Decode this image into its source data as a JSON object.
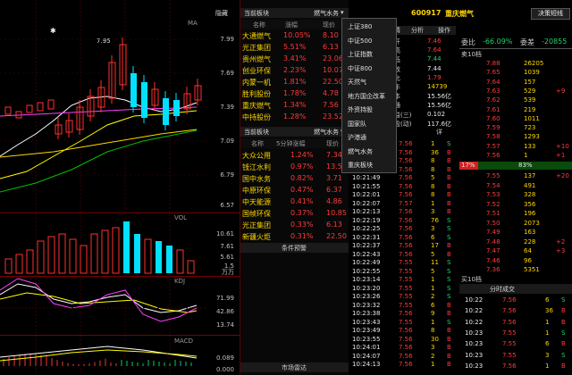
{
  "top_bar": {
    "hide_label": "隐藏",
    "watch_tab": "当前板块",
    "sector_tab": "燃气水务",
    "code": "600917",
    "name": "重庆燃气",
    "decide_button": "决策短线"
  },
  "chart": {
    "indicator_ma": "MA",
    "indicator_vol": "VOL",
    "indicator_kdj": "KDJ",
    "indicator_macd": "MACD",
    "peak_label": "7.95",
    "price_axis": [
      "7.99",
      "7.69",
      "7.39",
      "7.09",
      "6.79",
      "6.57"
    ],
    "vol_axis": [
      "10.61",
      "7.61",
      "5.61",
      "1.5",
      "万万"
    ],
    "kdj_axis": [
      "71.99",
      "42.86",
      "13.74"
    ],
    "macd_axis": [
      "0.089",
      "0.000"
    ]
  },
  "mid_panel": {
    "header_name": "名称",
    "header_chg": "涨幅",
    "header_price": "现价",
    "top_list": [
      {
        "name": "大通燃气",
        "chg": "10.05%",
        "price": "8.10"
      },
      {
        "name": "光正集团",
        "chg": "5.51%",
        "price": "6.13"
      },
      {
        "name": "贵州燃气",
        "chg": "3.41%",
        "price": "23.06"
      },
      {
        "name": "创业环保",
        "chg": "2.23%",
        "price": "10.07"
      },
      {
        "name": "内蒙一机",
        "chg": "1.81%",
        "price": "22.50"
      },
      {
        "name": "胜利股份",
        "chg": "1.78%",
        "price": "4.78"
      },
      {
        "name": "重庆燃气",
        "chg": "1.34%",
        "price": "7.56"
      },
      {
        "name": "中持股份",
        "chg": "1.28%",
        "price": "23.52"
      }
    ],
    "second_tab": "当前板块",
    "second_sector": "燃气水务",
    "header2_name": "名称",
    "header2_chg": "5分钟涨幅",
    "header2_price": "现价",
    "second_list": [
      {
        "name": "大众公用",
        "chg": "1.24%",
        "price": "7.34"
      },
      {
        "name": "钱江水利",
        "chg": "0.97%",
        "price": "13.54"
      },
      {
        "name": "国中水务",
        "chg": "0.82%",
        "price": "3.71"
      },
      {
        "name": "中原环保",
        "chg": "0.47%",
        "price": "6.37"
      },
      {
        "name": "中天能源",
        "chg": "0.41%",
        "price": "4.86"
      },
      {
        "name": "国帧环保",
        "chg": "0.37%",
        "price": "10.85"
      },
      {
        "name": "光正集团",
        "chg": "0.33%",
        "price": "6.13"
      },
      {
        "name": "新疆火炬",
        "chg": "0.31%",
        "price": "22.50"
      }
    ],
    "condition_label": "条件预警",
    "market_radar": "市场雷达"
  },
  "dropdown": {
    "items": [
      "上证380",
      "中证500",
      "上证指数",
      "中证800",
      "天然气",
      "地方国企改革",
      "外资持股",
      "国家队",
      "沪港通",
      "燃气水务",
      "重庆板块"
    ]
  },
  "quote": {
    "tab_detail": "详情",
    "tab_analysis": "分析",
    "tab_ops": "操作",
    "weibi_label": "委比",
    "weibi": "-66.09%",
    "weicha_label": "委差",
    "weicha": "-20855",
    "open_label": "今开",
    "open": "7.46",
    "high_label": "最高",
    "high": "7.64",
    "low_label": "最低",
    "low": "7.44",
    "prev_label": "昨收",
    "prev": "7.44",
    "ratio_label": "量比",
    "ratio": "1.79",
    "turn_label": "换手",
    "turn": "14739",
    "share_label": "股本",
    "share": "15.56亿",
    "flow_label": "流通",
    "flow": "15.56亿",
    "eps_label": "收益(三)",
    "eps": "0.102",
    "pe_label": "市盈(动)",
    "pe": "117.6亿",
    "sell_header": "卖10档",
    "buy_header": "买10档",
    "sell_rows": [
      {
        "price": "7.88",
        "vol": "26205"
      },
      {
        "price": "7.65",
        "vol": "1039"
      },
      {
        "price": "7.64",
        "vol": "157"
      },
      {
        "price": "7.63",
        "vol": "529",
        "chg": "+9"
      },
      {
        "price": "7.62",
        "vol": "539"
      },
      {
        "price": "7.61",
        "vol": "219"
      },
      {
        "price": "7.60",
        "vol": "1011"
      },
      {
        "price": "7.59",
        "vol": "723"
      },
      {
        "price": "7.58",
        "vol": "1293"
      },
      {
        "price": "7.57",
        "vol": "133",
        "chg": "+10"
      },
      {
        "price": "7.56",
        "vol": "1",
        "chg": "+1"
      }
    ],
    "bar_pct_left": "17%",
    "bar_pct_right": "83%",
    "buy_rows": [
      {
        "price": "7.55",
        "vol": "137",
        "chg": "+20"
      },
      {
        "price": "7.54",
        "vol": "491"
      },
      {
        "price": "7.53",
        "vol": "328"
      },
      {
        "price": "7.52",
        "vol": "356"
      },
      {
        "price": "7.51",
        "vol": "196"
      },
      {
        "price": "7.50",
        "vol": "2073"
      },
      {
        "price": "7.49",
        "vol": "163"
      },
      {
        "price": "7.48",
        "vol": "228",
        "chg": "+2"
      },
      {
        "price": "7.47",
        "vol": "64",
        "chg": "+3"
      },
      {
        "price": "7.46",
        "vol": "96"
      },
      {
        "price": "7.36",
        "vol": "5351"
      }
    ],
    "minute_title": "分时成交",
    "minute_rows": [
      {
        "t": "10:22",
        "p": "7.56",
        "v": "6",
        "f": "S"
      },
      {
        "t": "10:22",
        "p": "7.56",
        "v": "36",
        "f": "B"
      },
      {
        "t": "10:22",
        "p": "7.56",
        "v": "1",
        "f": "B"
      },
      {
        "t": "10:23",
        "p": "7.55",
        "v": "1",
        "f": "S"
      },
      {
        "t": "10:23",
        "p": "7.55",
        "v": "6",
        "f": "B"
      },
      {
        "t": "10:23",
        "p": "7.55",
        "v": "3",
        "f": "S"
      },
      {
        "t": "10:23",
        "p": "7.56",
        "v": "1",
        "f": "B"
      }
    ]
  },
  "trades": {
    "label_detail": "成交",
    "detail_btn": "详",
    "rows": [
      {
        "t": "",
        "p": "7.56",
        "v": "1",
        "f": "S"
      },
      {
        "t": "",
        "p": "7.56",
        "v": "36",
        "f": "B"
      },
      {
        "t": "",
        "p": "7.56",
        "v": "8",
        "f": "B"
      },
      {
        "t": "10:21:46",
        "p": "7.56",
        "v": "8",
        "f": "B"
      },
      {
        "t": "10:21:49",
        "p": "7.56",
        "v": "5",
        "f": "B"
      },
      {
        "t": "10:21:55",
        "p": "7.56",
        "v": "8",
        "f": "B"
      },
      {
        "t": "10:22:01",
        "p": "7.56",
        "v": "8",
        "f": "B"
      },
      {
        "t": "10:22:07",
        "p": "7.57",
        "v": "1",
        "f": "B"
      },
      {
        "t": "10:22:13",
        "p": "7.56",
        "v": "3",
        "f": "B"
      },
      {
        "t": "10:22:19",
        "p": "7.56",
        "v": "76",
        "f": "S"
      },
      {
        "t": "10:22:25",
        "p": "7.56",
        "v": "3",
        "f": "S"
      },
      {
        "t": "10:22:31",
        "p": "7.56",
        "v": "6",
        "f": "S"
      },
      {
        "t": "10:22:37",
        "p": "7.56",
        "v": "17",
        "f": "B"
      },
      {
        "t": "10:22:43",
        "p": "7.56",
        "v": "5",
        "f": "B"
      },
      {
        "t": "10:22:49",
        "p": "7.55",
        "v": "11",
        "f": "S"
      },
      {
        "t": "10:22:55",
        "p": "7.55",
        "v": "5",
        "f": "S"
      },
      {
        "t": "10:23:14",
        "p": "7.55",
        "v": "1",
        "f": "S"
      },
      {
        "t": "10:23:20",
        "p": "7.55",
        "v": "1",
        "f": "S"
      },
      {
        "t": "10:23:26",
        "p": "7.55",
        "v": "2",
        "f": "S"
      },
      {
        "t": "10:23:32",
        "p": "7.55",
        "v": "6",
        "f": "B"
      },
      {
        "t": "10:23:38",
        "p": "7.56",
        "v": "9",
        "f": "B"
      },
      {
        "t": "10:23:43",
        "p": "7.55",
        "v": "1",
        "f": "S"
      },
      {
        "t": "10:23:49",
        "p": "7.56",
        "v": "8",
        "f": "B"
      },
      {
        "t": "10:23:55",
        "p": "7.56",
        "v": "30",
        "f": "B"
      },
      {
        "t": "10:24:01",
        "p": "7.56",
        "v": "3",
        "f": "B"
      },
      {
        "t": "10:24:07",
        "p": "7.56",
        "v": "2",
        "f": "B"
      },
      {
        "t": "10:24:13",
        "p": "7.56",
        "v": "1",
        "f": "B"
      }
    ]
  }
}
